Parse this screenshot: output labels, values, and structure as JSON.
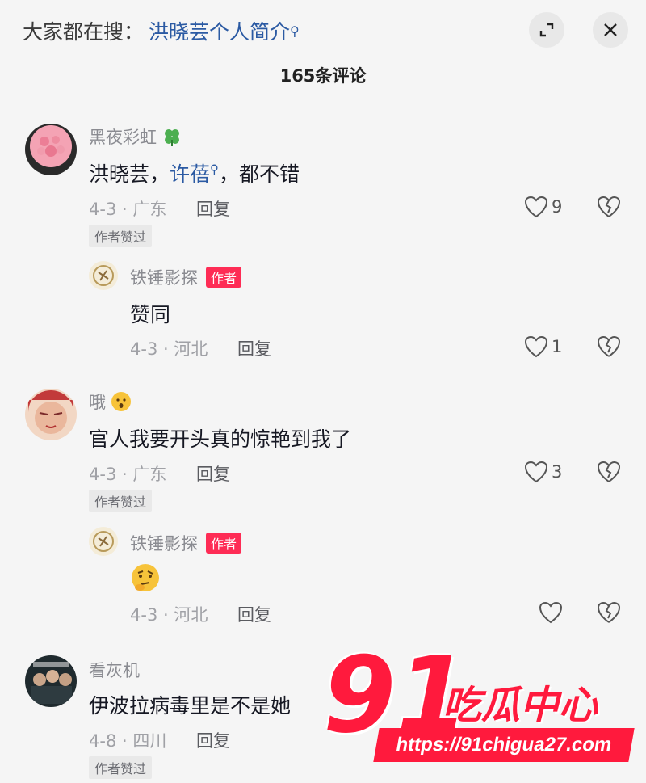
{
  "header": {
    "search_prefix": "大家都在搜：",
    "search_query": "洪晓芸个人简介",
    "comment_count": "165条评论"
  },
  "comments": [
    {
      "username": "黑夜彩虹",
      "text_before": "洪晓芸，",
      "text_link": "许蓓",
      "text_after": "，都不错",
      "date_location": "4-3 · 广东",
      "reply_label": "回复",
      "liked_by_author": "作者赞过",
      "likes": "9",
      "replies": [
        {
          "username": "铁锤影探",
          "badge": "作者",
          "text": "赞同",
          "date_location": "4-3 · 河北",
          "reply_label": "回复",
          "likes": "1"
        }
      ]
    },
    {
      "username": "哦",
      "text": "官人我要开头真的惊艳到我了",
      "date_location": "4-3 · 广东",
      "reply_label": "回复",
      "liked_by_author": "作者赞过",
      "likes": "3",
      "replies": [
        {
          "username": "铁锤影探",
          "badge": "作者",
          "text": "",
          "date_location": "4-3 · 河北",
          "reply_label": "回复",
          "likes": ""
        }
      ]
    },
    {
      "username": "看灰机",
      "text": "伊波拉病毒里是不是她",
      "date_location": "4-8 · 四川",
      "reply_label": "回复",
      "liked_by_author": "作者赞过"
    }
  ],
  "watermark": {
    "number": "91",
    "name": "吃瓜中心",
    "url": "https://91chigua27.com"
  },
  "colors": {
    "accent": "#fe2c55",
    "link": "#2b5aa3",
    "watermark": "#ff1a3d"
  }
}
